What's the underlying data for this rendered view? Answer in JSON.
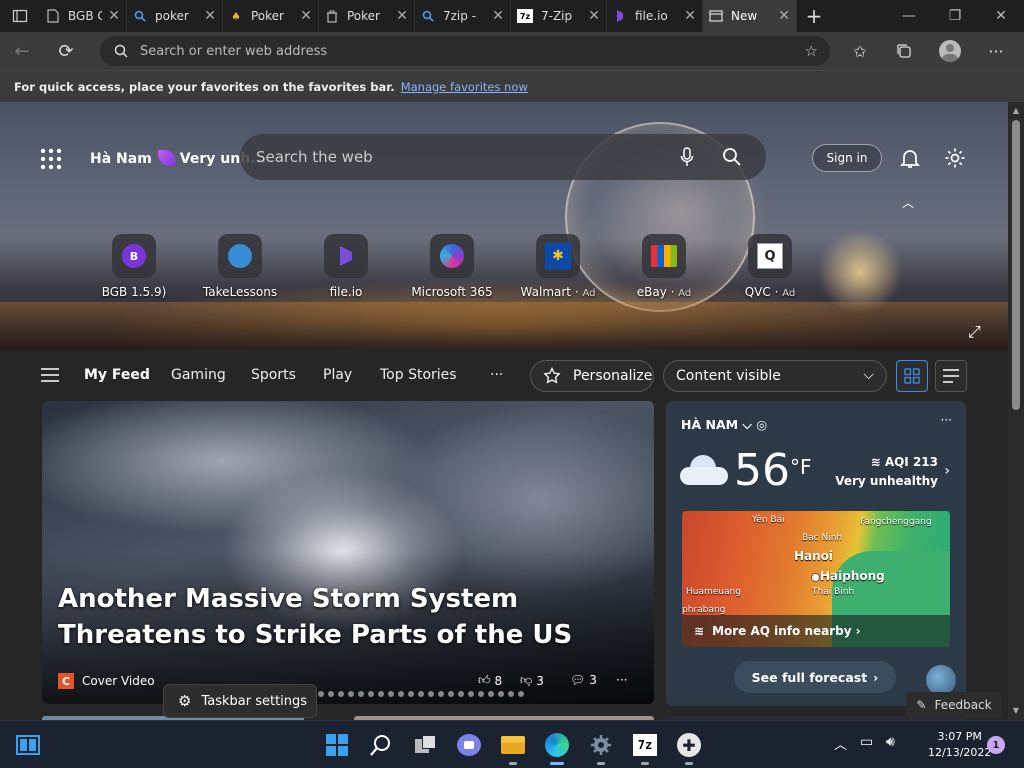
{
  "tabs": [
    {
      "label": "BGB C",
      "icon": "document-icon"
    },
    {
      "label": "poker",
      "icon": "search-icon"
    },
    {
      "label": "Poker",
      "icon": "poker-icon"
    },
    {
      "label": "Poker",
      "icon": "trash-icon"
    },
    {
      "label": "7zip -",
      "icon": "search-icon"
    },
    {
      "label": "7-Zip",
      "icon": "7zip-icon"
    },
    {
      "label": "file.io",
      "icon": "fileio-icon"
    },
    {
      "label": "New",
      "icon": "newtab-icon"
    }
  ],
  "address": {
    "placeholder": "Search or enter web address"
  },
  "favbar": {
    "text": "For quick access, place your favorites on the favorites bar.",
    "link": "Manage favorites now"
  },
  "hero": {
    "location": "Hà Nam",
    "aqi_short": "Very unh...",
    "search_placeholder": "Search the web",
    "sign_in": "Sign in"
  },
  "quick_links": [
    {
      "label": "BGB 1.5.9)",
      "ad": "",
      "glyph": "B",
      "color": "#7a35d9"
    },
    {
      "label": "TakeLessons",
      "ad": "",
      "glyph": "",
      "color": "#3a8ad6"
    },
    {
      "label": "file.io",
      "ad": "",
      "glyph": "",
      "color": "#6a3ad6"
    },
    {
      "label": "Microsoft 365",
      "ad": "",
      "glyph": "",
      "color": "#3a6ad6"
    },
    {
      "label": "Walmart",
      "ad": "Ad",
      "glyph": "✱",
      "color": "#0a4aa8"
    },
    {
      "label": "eBay",
      "ad": "Ad",
      "glyph": "",
      "color": "#222"
    },
    {
      "label": "QVC",
      "ad": "Ad",
      "glyph": "Q",
      "color": "#ffffff"
    }
  ],
  "feed": {
    "tabs": [
      "My Feed",
      "Gaming",
      "Sports",
      "Play",
      "Top Stories"
    ],
    "more": "···",
    "personalize": "Personalize",
    "content_visible": "Content visible"
  },
  "story": {
    "headline": "Another Massive Storm System Threatens to Strike Parts of the US",
    "source": "Cover Video",
    "source_glyph": "C",
    "likes": "8",
    "dislikes": "3",
    "comments": "3",
    "more": "···"
  },
  "weather": {
    "location": "HÀ NAM",
    "temp": "56",
    "unit": "°F",
    "aqi": "AQI 213",
    "aqi_label": "Very unhealthy",
    "map_cities": [
      "Yên Bái",
      "Fangchenggang",
      "Bac Ninh",
      "Hanoi",
      "Haiphong",
      "Huameuang",
      "Thái Bình",
      "phrabang"
    ],
    "more_aq": "More AQ info nearby",
    "forecast": "See full forecast",
    "more": "···"
  },
  "taskbar_settings": "Taskbar settings",
  "feedback": "Feedback",
  "clock": {
    "time": "3:07 PM",
    "date": "12/13/2022"
  },
  "notifications": "1",
  "colors": {
    "accent": "#3a8ee6",
    "link": "#7fb8ff",
    "weather_panel": "#2c3a47"
  }
}
